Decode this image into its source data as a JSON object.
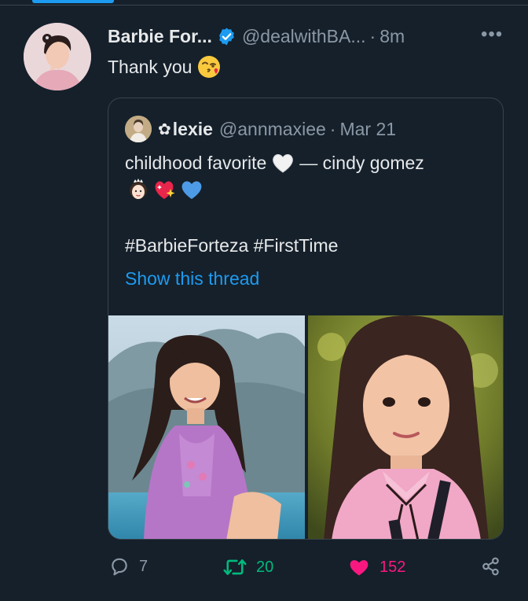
{
  "tweet": {
    "author_name": "Barbie For...",
    "author_handle": "@dealwithBA...",
    "separator": "·",
    "time": "8m",
    "more": "•••",
    "text": "Thank you",
    "emoji": "face-blowing-kiss"
  },
  "quote": {
    "flower": "✿",
    "author_name": "lexie",
    "author_handle": "@annmaxiee",
    "separator": "·",
    "date": "Mar 21",
    "line_before_heart": "childhood favorite",
    "line_after_heart": "— cindy gomez",
    "emojis": [
      "princess",
      "sparkling-heart",
      "blue-heart"
    ],
    "hashtags": "#BarbieForteza #FirstTime",
    "thread_link": "Show this thread",
    "photos": [
      "photo-girl-purple-dress-mountains",
      "photo-girl-school-uniform"
    ]
  },
  "actions": {
    "reply_count": "7",
    "retweet_count": "20",
    "like_count": "152"
  },
  "colors": {
    "background": "#15202b",
    "accent": "#1d9bf0",
    "retweet": "#00ba7c",
    "like": "#f91880",
    "muted": "#8b98a5"
  }
}
